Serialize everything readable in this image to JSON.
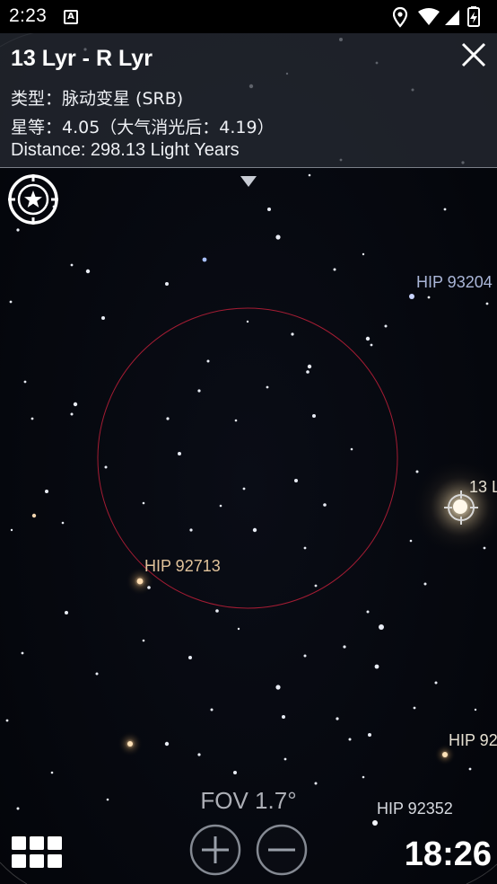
{
  "status_bar": {
    "time": "2:23",
    "notification_glyph": "A",
    "icons": [
      "location-icon",
      "wifi-icon",
      "signal-icon",
      "battery-charging-icon"
    ]
  },
  "info_panel": {
    "title": "13 Lyr - R Lyr",
    "type_line": "类型：脉动变星 (SRB)",
    "magnitude_line": "星等：4.05（大气消光后：4.19）",
    "distance_line": "Distance: 298.13 Light Years"
  },
  "sky_labels": {
    "hip93204": "HIP 93204",
    "lyr13": "13 L",
    "hip92713": "HIP 92713",
    "hip92_edge": "HIP 92",
    "hip92352": "HIP 92352"
  },
  "fov": "FOV 1.7°",
  "clock": "18:26",
  "colors": {
    "fov_circle": "#c0203a",
    "background": "#05070d",
    "panel": "#282c34"
  }
}
